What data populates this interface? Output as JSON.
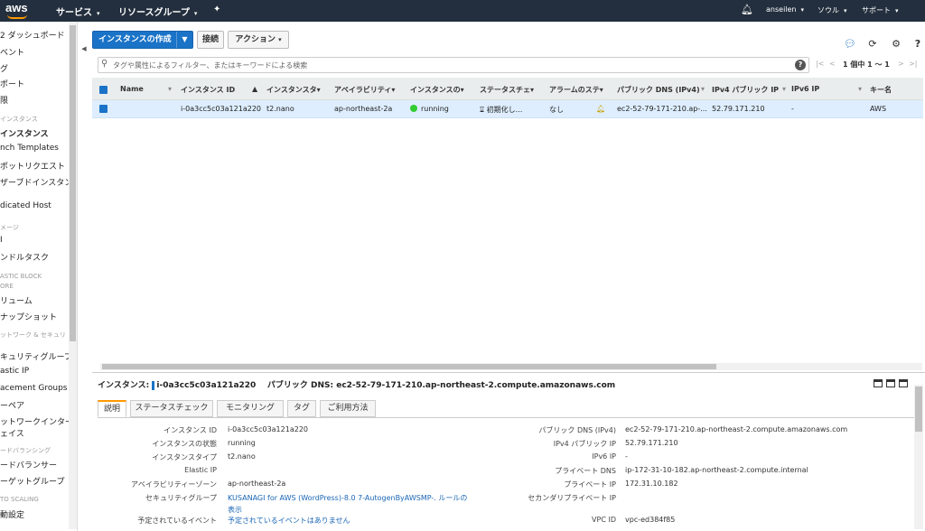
{
  "topbar": {
    "logo": "aws",
    "services": "サービス",
    "resource_groups": "リソースグループ",
    "user": "anseilen",
    "region": "ソウル",
    "support": "サポート"
  },
  "sidebar": {
    "items": [
      {
        "label": "2 ダッシュボード"
      },
      {
        "label": "ベント"
      },
      {
        "label": "グ"
      },
      {
        "label": "ポート"
      },
      {
        "label": "限"
      },
      {
        "label": "インスタンス",
        "section": true
      },
      {
        "label": "インスタンス",
        "active": true
      },
      {
        "label": "nch Templates"
      },
      {
        "label": "ポットリクエスト"
      },
      {
        "label": "ザーブドインスタン"
      },
      {
        "label": "dicated Host"
      },
      {
        "label": "メージ",
        "section": true
      },
      {
        "label": "I"
      },
      {
        "label": "ンドルタスク"
      },
      {
        "label": "ASTIC BLOCK",
        "section": true
      },
      {
        "label": "ORE",
        "section": true
      },
      {
        "label": "リューム"
      },
      {
        "label": "ナップショット"
      },
      {
        "label": "ットワーク & セキュリ",
        "section": true
      },
      {
        "label": "キュリティグループ"
      },
      {
        "label": "astic IP"
      },
      {
        "label": "acement Groups"
      },
      {
        "label": "ーペア"
      },
      {
        "label": "ットワークインター"
      },
      {
        "label": "ェイス"
      },
      {
        "label": "ードバランシング",
        "section": true
      },
      {
        "label": "ードバランサー"
      },
      {
        "label": "ーゲットグループ"
      },
      {
        "label": "TO SCALING",
        "section": true
      },
      {
        "label": "動設定"
      }
    ]
  },
  "toolbar": {
    "launch": "インスタンスの作成",
    "connect": "接続",
    "actions": "アクション"
  },
  "search": {
    "placeholder": "タグや属性によるフィルター、またはキーワードによる検索",
    "pager": "1 個中 1 ～ 1"
  },
  "table": {
    "headers": [
      "Name",
      "インスタンス ID",
      "インスタンスタ▾",
      "アベイラビリティ▾",
      "インスタンスの▾",
      "ステータスチェ▾",
      "アラームのステ▾",
      "パブリック DNS (IPv4)",
      "IPv4 パブリック IP",
      "IPv6 IP",
      "キー名"
    ],
    "row": {
      "name": "",
      "instance_id": "i-0a3cc5c03a121a220",
      "type": "t2.nano",
      "az": "ap-northeast-2a",
      "state": "running",
      "status_check": "初期化し...",
      "alarm": "なし",
      "public_dns": "ec2-52-79-171-210.ap-...",
      "public_ip": "52.79.171.210",
      "ipv6": "-",
      "key": "AWS"
    }
  },
  "detail": {
    "title_label": "インスタンス:",
    "title_id": "i-0a3cc5c03a121a220",
    "title_dns_label": "パブリック DNS:",
    "title_dns": "ec2-52-79-171-210.ap-northeast-2.compute.amazonaws.com",
    "tabs": [
      "説明",
      "ステータスチェック",
      "モニタリング",
      "タグ",
      "ご利用方法"
    ],
    "left": [
      {
        "label": "インスタンス ID",
        "value": "i-0a3cc5c03a121a220"
      },
      {
        "label": "インスタンスの状態",
        "value": "running"
      },
      {
        "label": "インスタンスタイプ",
        "value": "t2.nano"
      },
      {
        "label": "Elastic IP",
        "value": ""
      },
      {
        "label": "アベイラビリティーゾーン",
        "value": "ap-northeast-2a"
      },
      {
        "label": "セキュリティグループ",
        "value": "KUSANAGI for AWS (WordPress)-8.0 7-AutogenByAWSMP-. ルールの"
      },
      {
        "label": "",
        "value": "表示"
      },
      {
        "label": "予定されているイベント",
        "value": "予定されているイベントはありません"
      }
    ],
    "right": [
      {
        "label": "パブリック DNS (IPv4)",
        "value": "ec2-52-79-171-210.ap-northeast-2.compute.amazonaws.com"
      },
      {
        "label": "IPv4 パブリック IP",
        "value": "52.79.171.210"
      },
      {
        "label": "IPv6 IP",
        "value": "-"
      },
      {
        "label": "プライベート DNS",
        "value": "ip-172-31-10-182.ap-northeast-2.compute.internal"
      },
      {
        "label": "プライベート IP",
        "value": "172.31.10.182"
      },
      {
        "label": "セカンダリプライベート IP",
        "value": ""
      },
      {
        "label": "",
        "value": ""
      },
      {
        "label": "VPC ID",
        "value": "vpc-ed384f85"
      }
    ]
  }
}
